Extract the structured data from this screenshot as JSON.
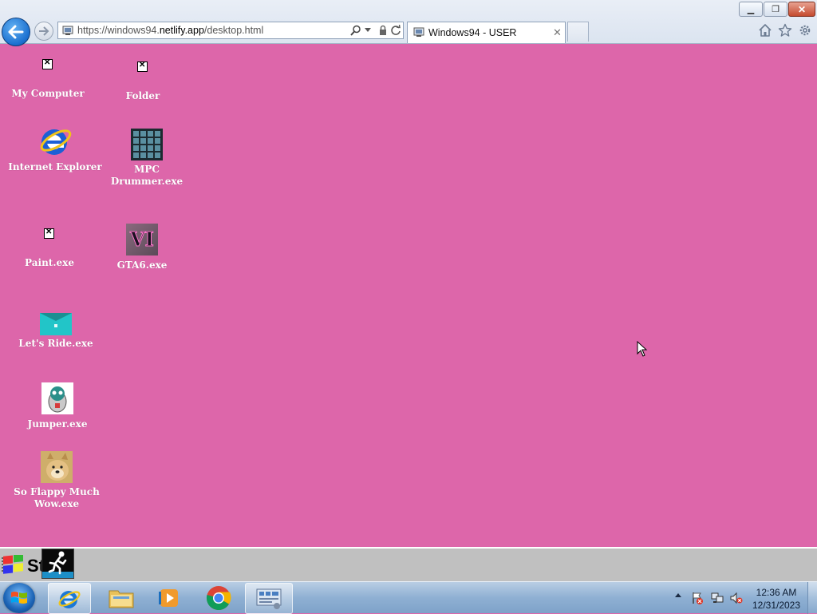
{
  "browser": {
    "url_prefix": "https://windows94.",
    "url_domain": "netlify.app",
    "url_path": "/desktop.html",
    "tab_title": "Windows94 - USER",
    "tab_close_glyph": "✕",
    "window_controls": {
      "minimize": "▁",
      "maximize": "❐",
      "close": "✕"
    }
  },
  "desktop": {
    "background_color": "#dd66aa",
    "icons": [
      {
        "label": "My Computer",
        "icon": "broken-image-icon"
      },
      {
        "label": "Folder",
        "icon": "broken-image-icon"
      },
      {
        "label": "Internet Explorer",
        "icon": "internet-explorer-icon"
      },
      {
        "label": "MPC Drummer.exe",
        "icon": "mpc-drum-pad-icon"
      },
      {
        "label": "Paint.exe",
        "icon": "broken-image-icon"
      },
      {
        "label": "GTA6.exe",
        "icon": "gta6-icon",
        "icon_text": "VI"
      },
      {
        "label": "Let's Ride.exe",
        "icon": "lets-ride-icon"
      },
      {
        "label": "Jumper.exe",
        "icon": "jumper-icon"
      },
      {
        "label": "So Flappy Much Wow.exe",
        "icon": "doge-icon"
      }
    ]
  },
  "win94_taskbar": {
    "start_label": "St"
  },
  "win7_taskbar": {
    "pinned": [
      {
        "name": "Internet Explorer",
        "icon": "ie-icon",
        "active": true
      },
      {
        "name": "Windows Explorer",
        "icon": "folder-icon"
      },
      {
        "name": "Windows Media Player",
        "icon": "media-player-icon"
      },
      {
        "name": "Google Chrome",
        "icon": "chrome-icon"
      },
      {
        "name": "Control Panel",
        "icon": "control-panel-icon",
        "active": true
      }
    ],
    "clock": {
      "time": "12:36 AM",
      "date": "12/31/2023"
    }
  }
}
